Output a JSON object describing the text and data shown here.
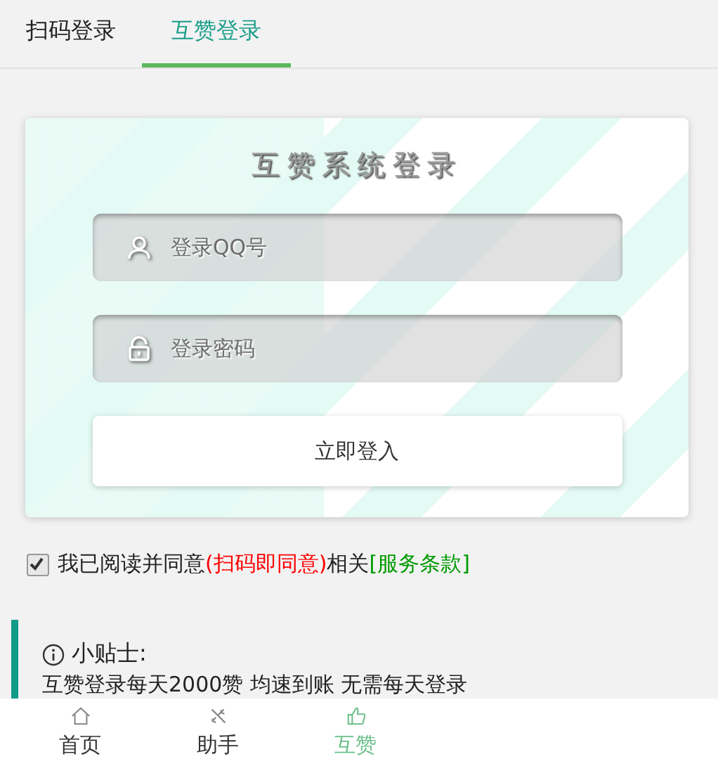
{
  "tabs": [
    {
      "label": "扫码登录",
      "selected": false
    },
    {
      "label": "互赞登录",
      "selected": true
    }
  ],
  "login_card": {
    "title": "互赞系统登录",
    "fields": [
      {
        "kind": "user",
        "placeholder": "登录QQ号"
      },
      {
        "kind": "lock",
        "placeholder": "登录密码"
      }
    ],
    "button": "立即登入"
  },
  "agreement": {
    "checked": true,
    "text": "我已阅读并同意",
    "note": "(扫码即同意)",
    "middle": "相关",
    "link": "[服务条款]"
  },
  "tip": {
    "title": "小贴士:",
    "text": "互赞登录每天2000赞 均速到账 无需每天登录"
  },
  "bottom_nav": [
    {
      "kind": "home",
      "label": "首页",
      "selected": false
    },
    {
      "kind": "tools",
      "label": "助手",
      "selected": false
    },
    {
      "kind": "like",
      "label": "互赞",
      "selected": true
    }
  ]
}
